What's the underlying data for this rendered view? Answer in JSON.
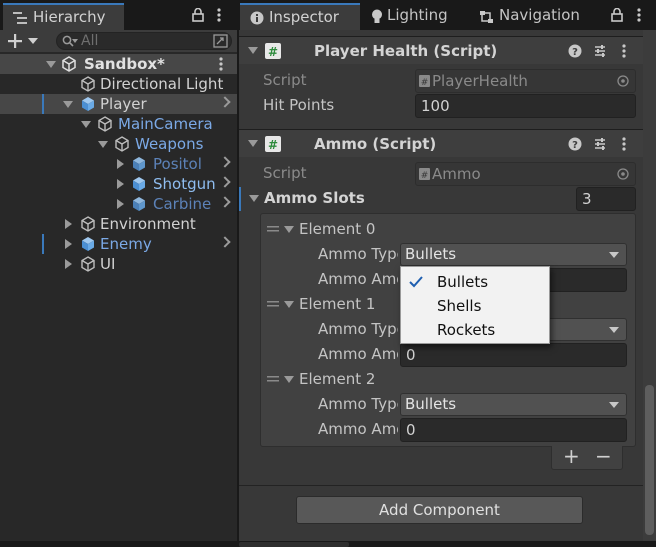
{
  "hierarchy": {
    "tab_label": "Hierarchy",
    "search_placeholder": "All",
    "scene_name": "Sandbox*",
    "items": [
      {
        "label": "Directional Light"
      },
      {
        "label": "Player"
      },
      {
        "label": "MainCamera"
      },
      {
        "label": "Weapons"
      },
      {
        "label": "Positol"
      },
      {
        "label": "Shotgun"
      },
      {
        "label": "Carbine"
      },
      {
        "label": "Environment"
      },
      {
        "label": "Enemy"
      },
      {
        "label": "UI"
      }
    ]
  },
  "inspector": {
    "tabs": [
      {
        "label": "Inspector"
      },
      {
        "label": "Lighting"
      },
      {
        "label": "Navigation"
      }
    ],
    "player_health": {
      "title": "Player Health (Script)",
      "script_label": "Script",
      "script_value": "PlayerHealth",
      "hit_points_label": "Hit Points",
      "hit_points_value": "100"
    },
    "ammo": {
      "title": "Ammo (Script)",
      "script_label": "Script",
      "script_value": "Ammo",
      "slots_label": "Ammo Slots",
      "slots_count": "3",
      "elements": [
        {
          "label": "Element 0",
          "type_label": "Ammo Type",
          "type_value": "Bullets",
          "amount_label": "Ammo Amount",
          "amount_value": ""
        },
        {
          "label": "Element 1",
          "type_label": "Ammo Type",
          "type_value": "",
          "amount_label": "Ammo Amount",
          "amount_value": "0"
        },
        {
          "label": "Element 2",
          "type_label": "Ammo Type",
          "type_value": "Bullets",
          "amount_label": "Ammo Amount",
          "amount_value": "0"
        }
      ],
      "add_label": "+",
      "remove_label": "−"
    },
    "add_component_label": "Add Component"
  },
  "dropdown_popup": {
    "options": [
      {
        "label": "Bullets",
        "checked": true
      },
      {
        "label": "Shells",
        "checked": false
      },
      {
        "label": "Rockets",
        "checked": false
      }
    ]
  },
  "colors": {
    "accent_blue": "#3a79bb",
    "prefab_blue": "#7ba9e6",
    "prefab_dim_blue": "#5c82b8"
  }
}
